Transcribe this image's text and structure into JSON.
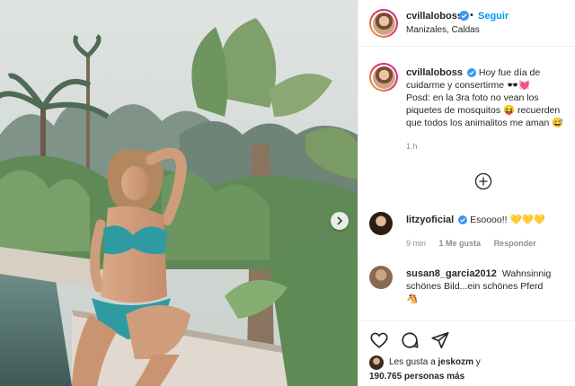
{
  "post": {
    "username": "cvillaloboss",
    "follow_label": "Seguir",
    "separator": "•",
    "location": "Manizales, Caldas",
    "caption_lines": [
      "Hoy fue día de",
      "cuidarme y consertirme 🕶️💓",
      "Posd: en la 3ra foto no vean los",
      "piquetes de mosquitos 😝 recuerden",
      "que todos los animalitos me aman 😅"
    ],
    "time_ago": "1 h"
  },
  "comments": [
    {
      "username": "litzyoficial",
      "text": "Esoooo!! 💛💛💛",
      "time": "9 min",
      "likes": "1 Me gusta",
      "reply": "Responder"
    },
    {
      "username": "susan8_garcia2012",
      "text_lines": [
        "Wahnsinnig",
        "schönes Bild...ein schönes Pferd",
        "🐴"
      ]
    }
  ],
  "likes": {
    "prefix": "Les gusta a",
    "user": "jeskozm",
    "suffix": "y",
    "count_text": "190.765 personas más"
  },
  "icons": {
    "verified": "verified-badge-icon",
    "more": "add-circle-icon",
    "like": "heart-outline-icon",
    "comment": "comment-bubble-icon",
    "share": "paper-plane-icon",
    "next": "chevron-right-icon"
  },
  "colors": {
    "accent": "#0095f6",
    "text": "#262626",
    "muted": "#8e8e8e",
    "border": "#efefef"
  }
}
